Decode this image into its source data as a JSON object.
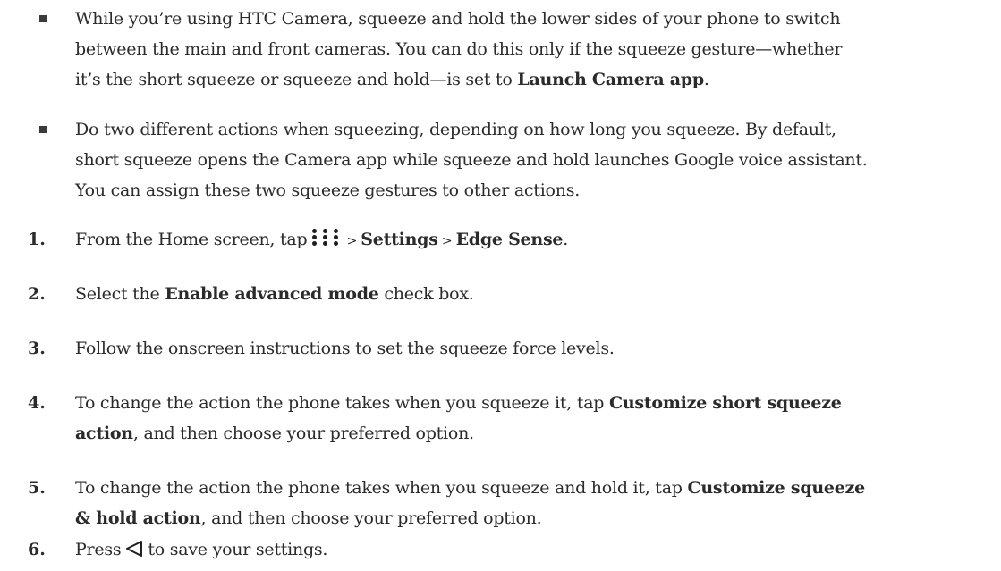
{
  "bullets": [
    {
      "line1": "While you’re using HTC Camera, squeeze and hold the lower sides of your phone to switch",
      "line2": "between the main and front cameras. You can do this only if the squeeze gesture—whether",
      "line3_before": "it’s the short squeeze or squeeze and hold—is set to ",
      "line3_bold": "Launch Camera app",
      "line3_after": "."
    },
    {
      "line1": "Do two different actions when squeezing, depending on how long you squeeze. By default,",
      "line2": "short squeeze opens the Camera app while squeeze and hold launches Google voice assistant.",
      "line3": "You can assign these two squeeze gestures to other actions."
    }
  ],
  "steps": [
    {
      "number": "1.",
      "before": "From the Home screen, tap",
      "icon": "apps-grid-icon",
      "sep1": " > ",
      "bold1": "Settings",
      "sep2": " > ",
      "bold2": "Edge Sense",
      "after": "."
    },
    {
      "number": "2.",
      "before": "Select the ",
      "bold": "Enable advanced mode",
      "after": " check box."
    },
    {
      "number": "3.",
      "text": "Follow the onscreen instructions to set the squeeze force levels."
    },
    {
      "number": "4.",
      "before": "To change the action the phone takes when you squeeze it, tap ",
      "bold1": "Customize short squeeze",
      "bold2": "action",
      "after": ", and then choose your preferred option."
    },
    {
      "number": "5.",
      "before": "To change the action the phone takes when you squeeze and hold it, tap ",
      "bold1": "Customize squeeze",
      "bold2": "& hold action",
      "after": ", and then choose your preferred option."
    },
    {
      "number": "6.",
      "before": "Press",
      "icon": "back-triangle-icon",
      "after": "to save your settings."
    }
  ],
  "colors": {
    "text": "#2b2b2b",
    "background": "#ffffff"
  }
}
